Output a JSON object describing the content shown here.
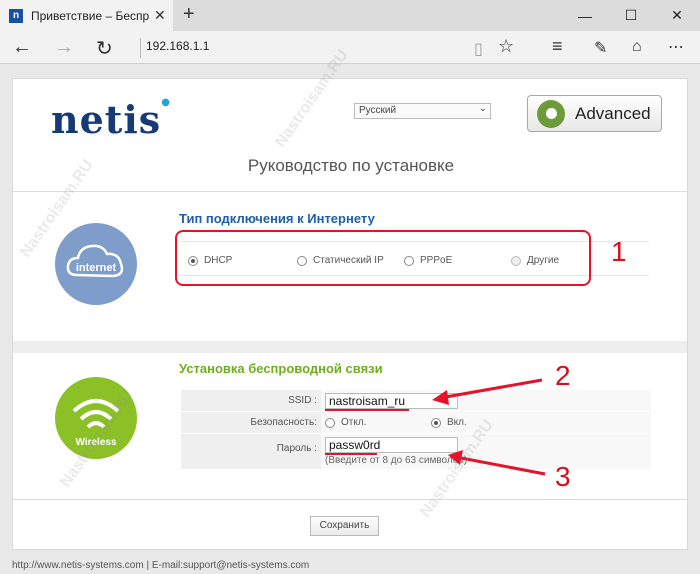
{
  "browser": {
    "tab_title": "Приветствие – Беспров",
    "tab_favicon": "n",
    "address": "192.168.1.1",
    "icons": [
      "back-icon",
      "forward-icon",
      "refresh-icon",
      "reading-view-icon",
      "favorite-star-icon",
      "hub-icon",
      "notes-icon",
      "share-icon",
      "more-icon"
    ]
  },
  "header": {
    "logo": "netis",
    "language": "Русский",
    "advanced_label": "Advanced"
  },
  "page_title": "Руководство по установке",
  "internet": {
    "section_title": "Тип подключения к Интернету",
    "icon_label": "internet",
    "options": [
      {
        "label": "DHCP",
        "selected": true
      },
      {
        "label": "Статический IP",
        "selected": false
      },
      {
        "label": "PPPoE",
        "selected": false
      },
      {
        "label": "Другие",
        "selected": false
      }
    ]
  },
  "wireless": {
    "section_title": "Установка беспроводной связи",
    "icon_label": "Wireless",
    "ssid_label": "SSID :",
    "ssid_value": "nastroisam_ru",
    "security_label": "Безопасность:",
    "security_off": "Откл.",
    "security_on": "Вкл.",
    "password_label": "Пароль :",
    "password_value": "passw0rd",
    "password_hint": "(Введите от 8 до 63 символов)"
  },
  "save_label": "Сохранить",
  "footer": "http://www.netis-systems.com | E-mail:support@netis-systems.com",
  "annotations": [
    "1",
    "2",
    "3"
  ],
  "watermark": "Nastroisam.RU",
  "colors": {
    "accent_blue": "#1e5fa8",
    "accent_green": "#6fae1f",
    "annotation_red": "#e4122a"
  }
}
